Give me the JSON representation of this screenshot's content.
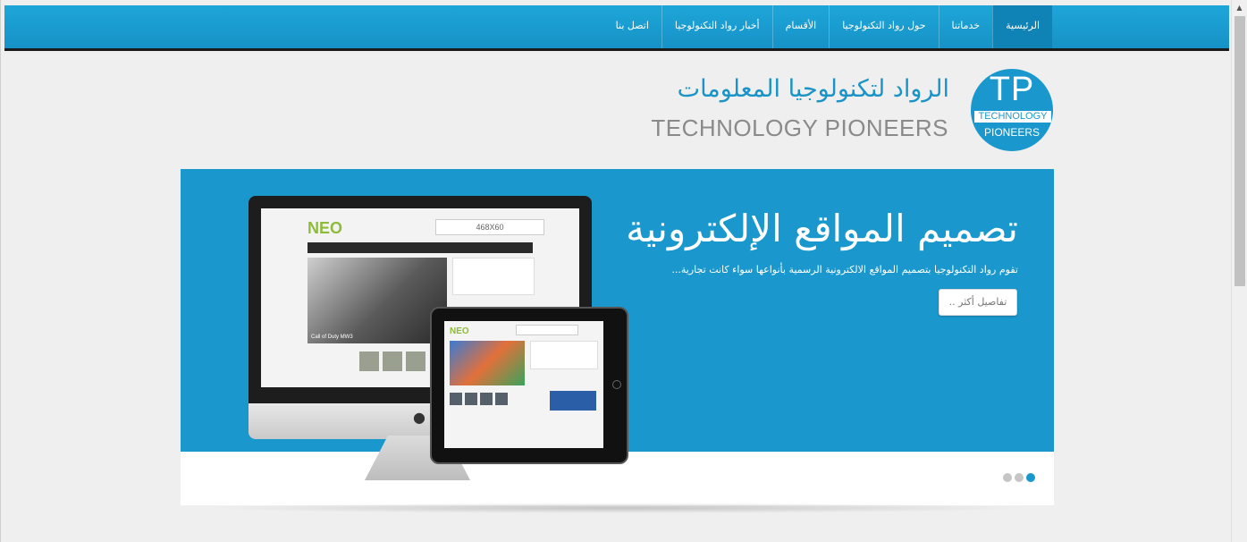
{
  "nav": {
    "items": [
      {
        "label": "الرئيسية",
        "active": true
      },
      {
        "label": "خدماتنا",
        "active": false
      },
      {
        "label": "حول رواد التكنولوجيا",
        "active": false
      },
      {
        "label": "الأقسام",
        "active": false
      },
      {
        "label": "أخبار رواد التكنولوجيا",
        "active": false
      },
      {
        "label": "اتصل بنا",
        "active": false
      }
    ]
  },
  "logo": {
    "arabic_name": "الرواد لتكنولوجيا المعلومات",
    "english_name": "TECHNOLOGY PIONEERS",
    "badge_initials": "TP",
    "badge_line1": "TECHNOLOGY",
    "badge_line2": "PIONEERS"
  },
  "slider": {
    "title": "تصميم المواقع الإلكترونية",
    "text": "تقوم رواد التكنولوجيا بتصميم المواقع الالكترونية الرسمية بأنواعها سواء كانت تجارية...",
    "button_label": "تفاصيل أكثر ..",
    "dots": [
      {
        "active": false
      },
      {
        "active": false
      },
      {
        "active": true
      }
    ],
    "mockup": {
      "monitor_logo": "NEO",
      "monitor_ad": "468X60",
      "monitor_caption": "Call of Duty MW3",
      "tablet_logo": "NEO"
    }
  },
  "colors": {
    "accent": "#1a98cd",
    "nav_bg": "#1ea6d8",
    "page_bg": "#efefef"
  },
  "icons": {
    "scroll_up": "triangle-up",
    "apple": "apple-logo"
  }
}
